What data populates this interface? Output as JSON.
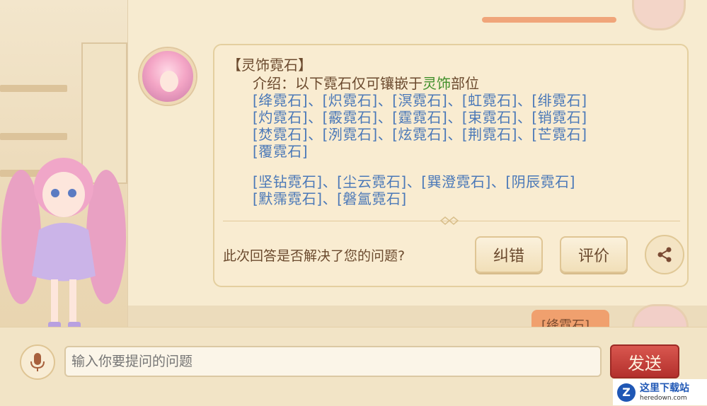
{
  "answer": {
    "title": "【灵饰霓石】",
    "intro_prefix": "介绍：以下霓石仅可镶嵌于",
    "intro_highlight": "灵饰",
    "intro_suffix": "部位",
    "stone_lines": [
      "[绛霓石]、[炽霓石]、[溟霓石]、[虹霓石]、[绯霓石]",
      "[灼霓石]、[霰霓石]、[霆霓石]、[束霓石]、[销霓石]",
      "[焚霓石]、[洌霓石]、[炫霓石]、[荆霓石]、[芒霓石]",
      "[覆霓石]",
      "[坚钻霓石]、[尘云霓石]、[巽澄霓石]、[阴辰霓石]",
      "[默霈霓石]、[磐氲霓石]"
    ],
    "feedback_question": "此次回答是否解决了您的问题?",
    "correct_button": "纠错",
    "rate_button": "评价"
  },
  "user_message_partial": "[绛霓石]",
  "input": {
    "placeholder": "输入你要提问的问题",
    "send_label": "发送"
  },
  "icons": {
    "mic": "microphone-icon",
    "share": "share-icon"
  },
  "watermark": {
    "logo": "Z",
    "title": "这里下载站",
    "url": "heredown.com"
  },
  "colors": {
    "stone_link": "#4a78b8",
    "highlight": "#3f8f2a",
    "send_button": "#c0392f"
  }
}
